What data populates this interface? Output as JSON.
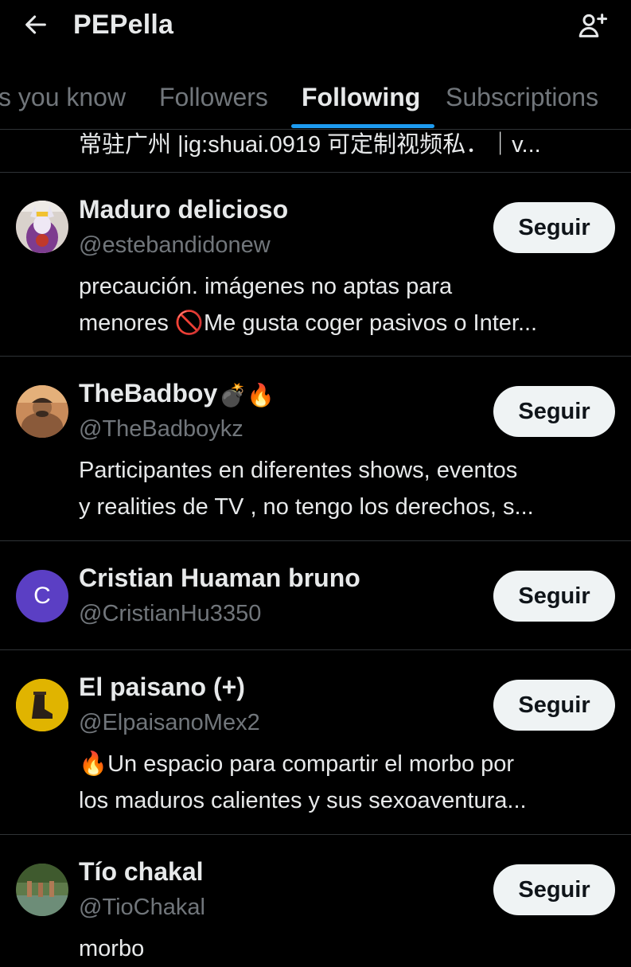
{
  "header": {
    "title": "PEPella",
    "back_icon": "arrow-left-icon",
    "add_icon": "add-person-icon"
  },
  "tabs": [
    {
      "label": "s you know",
      "active": false
    },
    {
      "label": "Followers",
      "active": false
    },
    {
      "label": "Following",
      "active": true
    },
    {
      "label": "Subscriptions",
      "active": false
    }
  ],
  "accent": "#1d9bf0",
  "previous_bio": "常驻广州 |ig:shuai.0919 可定制视频私．｜v...",
  "users": [
    {
      "name": "Maduro delicioso",
      "handle": "@estebandidonew",
      "bio_line1": "precaución. imágenes no aptas para",
      "bio_line2_pre": "menores ",
      "bio_line2_emoji": "🚫",
      "bio_line2_post": "Me gusta coger pasivos o Inter...",
      "follow_label": "Seguir"
    },
    {
      "name": "TheBadboy",
      "name_emojis": "💣🔥",
      "handle": "@TheBadboykz",
      "bio_line1": "Participantes en diferentes shows, eventos",
      "bio_line2": "y realities de TV , no tengo los derechos, s...",
      "follow_label": "Seguir"
    },
    {
      "name": "Cristian Huaman bruno",
      "handle": "@CristianHu3350",
      "avatar_letter": "C",
      "avatar_color": "#5b3fc4",
      "follow_label": "Seguir"
    },
    {
      "name": "El paisano (+)",
      "handle": "@ElpaisanoMex2",
      "avatar_color": "#e0b400",
      "bio_line1_emoji": "🔥",
      "bio_line1": "Un espacio para compartir el morbo por",
      "bio_line2": "los maduros calientes y sus sexoaventura...",
      "follow_label": "Seguir"
    },
    {
      "name": "Tío chakal",
      "handle": "@TioChakal",
      "bio_line1": "morbo",
      "follow_label": "Seguir"
    }
  ]
}
